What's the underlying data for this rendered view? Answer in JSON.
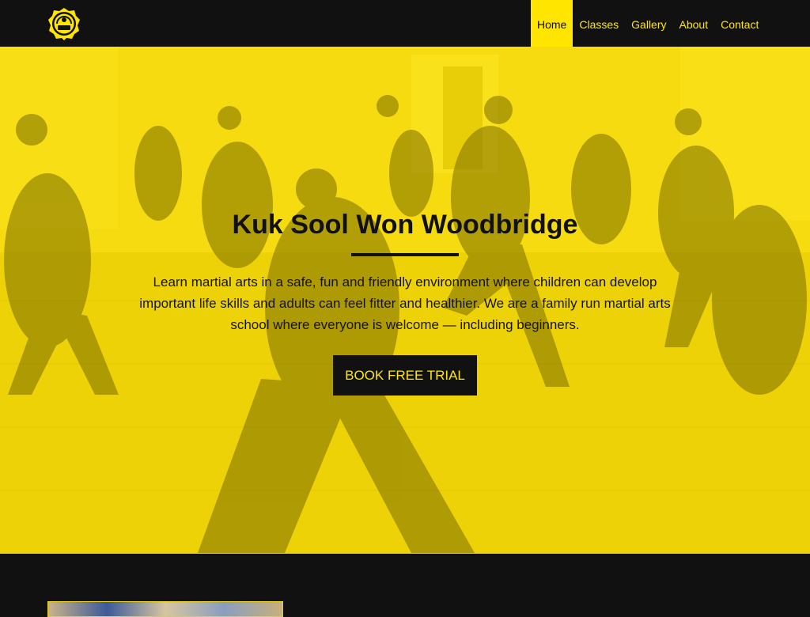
{
  "brand": {
    "logo_icon": "kuk-sool-won-emblem-icon",
    "accent": "#FFE500",
    "dark": "#111111"
  },
  "nav": {
    "items": [
      {
        "label": "Home",
        "active": true
      },
      {
        "label": "Classes",
        "active": false
      },
      {
        "label": "Gallery",
        "active": false
      },
      {
        "label": "About",
        "active": false
      },
      {
        "label": "Contact",
        "active": false
      }
    ]
  },
  "hero": {
    "title": "Kuk Sool Won Woodbridge",
    "text": "Learn martial arts in a safe, fun and friendly environment where children can develop important life skills and adults can feel fitter and healthier. We are a family run martial arts school where everyone is welcome — including beginners.",
    "cta_label": "BOOK FREE TRIAL"
  }
}
